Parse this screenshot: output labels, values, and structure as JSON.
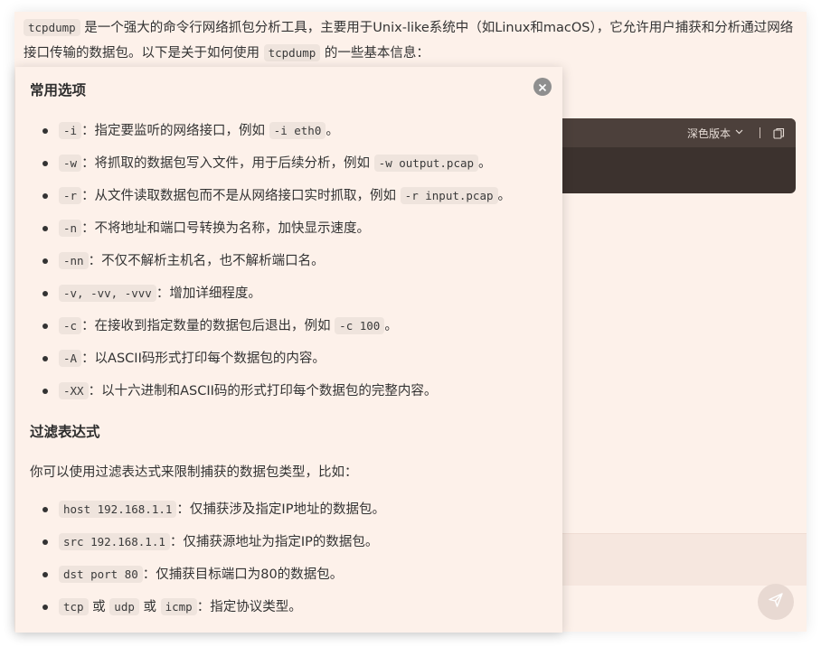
{
  "intro": {
    "part1_code": "tcpdump",
    "part1_text": " 是一个强大的命令行网络抓包分析工具，主要用于Unix-like系统中（如Linux和macOS），它允许用户捕获和分析通过网络接口传输的数据包。以下是关于如何使用 ",
    "part2_code": "tcpdump",
    "part2_text": " 的一些基本信息："
  },
  "code_block": {
    "theme_label": "深色版本",
    "chevron_icon": "chevron-down-icon",
    "copy_icon": "copy-icon"
  },
  "popup": {
    "close_icon": "close-icon",
    "section1_title": "常用选项",
    "options": [
      {
        "code": "-i",
        "text": "：指定要监听的网络接口，例如 ",
        "example": "-i eth0",
        "suffix": "。"
      },
      {
        "code": "-w",
        "text": "：将抓取的数据包写入文件，用于后续分析，例如 ",
        "example": "-w output.pcap",
        "suffix": "。"
      },
      {
        "code": "-r",
        "text": "：从文件读取数据包而不是从网络接口实时抓取，例如 ",
        "example": "-r input.pcap",
        "suffix": "。"
      },
      {
        "code": "-n",
        "text": "：不将地址和端口号转换为名称，加快显示速度。",
        "example": "",
        "suffix": ""
      },
      {
        "code": "-nn",
        "text": "：不仅不解析主机名，也不解析端口名。",
        "example": "",
        "suffix": ""
      },
      {
        "code": "-v, -vv, -vvv",
        "text": "：增加详细程度。",
        "example": "",
        "suffix": ""
      },
      {
        "code": "-c",
        "text": "：在接收到指定数量的数据包后退出，例如 ",
        "example": "-c 100",
        "suffix": "。"
      },
      {
        "code": "-A",
        "text": "：以ASCII码形式打印每个数据包的内容。",
        "example": "",
        "suffix": ""
      },
      {
        "code": "-XX",
        "text": "：以十六进制和ASCII码的形式打印每个数据包的完整内容。",
        "example": "",
        "suffix": ""
      }
    ],
    "section2_title": "过滤表达式",
    "section2_desc": "你可以使用过滤表达式来限制捕获的数据包类型，比如：",
    "filters": [
      {
        "code": "host 192.168.1.1",
        "text": "：仅捕获涉及指定IP地址的数据包。"
      },
      {
        "code": "src 192.168.1.1",
        "text": "：仅捕获源地址为指定IP的数据包。"
      },
      {
        "code": "dst port 80",
        "text": "：仅捕获目标端口为80的数据包。"
      }
    ],
    "protocol": {
      "code1": "tcp",
      "or1": " 或 ",
      "code2": "udp",
      "or2": " 或 ",
      "code3": "icmp",
      "text": "：指定协议类型。"
    }
  },
  "send_icon": "send-icon"
}
